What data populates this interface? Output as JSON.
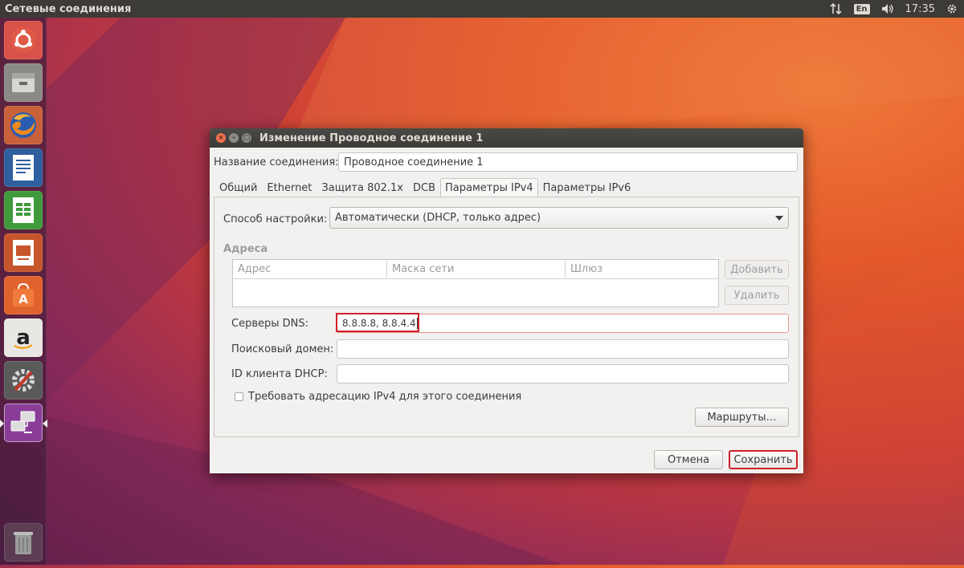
{
  "top_panel": {
    "app_title": "Сетевые соединения",
    "language": "En",
    "clock": "17:35"
  },
  "launcher": {
    "items": [
      "ubuntu-dash",
      "files",
      "firefox",
      "libreoffice-writer",
      "libreoffice-calc",
      "libreoffice-impress",
      "ubuntu-software",
      "amazon",
      "system-settings",
      "network-connections",
      "trash"
    ]
  },
  "dialog": {
    "title": "Изменение Проводное соединение 1",
    "connection_name_label": "Название соединения:",
    "connection_name_value": "Проводное соединение 1",
    "tabs": [
      {
        "label": "Общий"
      },
      {
        "label": "Ethernet"
      },
      {
        "label": "Защита 802.1x"
      },
      {
        "label": "DCB"
      },
      {
        "label": "Параметры IPv4"
      },
      {
        "label": "Параметры IPv6"
      }
    ],
    "active_tab": "Параметры IPv4",
    "method_label": "Способ настройки:",
    "method_value": "Автоматически (DHCP, только адрес)",
    "addresses_heading": "Адреса",
    "addresses_columns": [
      "Адрес",
      "Маска сети",
      "Шлюз"
    ],
    "add_button": "Добавить",
    "delete_button": "Удалить",
    "dns_label": "Серверы DNS:",
    "dns_value": "8.8.8.8, 8.8.4.4",
    "search_domain_label": "Поисковый домен:",
    "search_domain_value": "",
    "dhcp_client_id_label": "ID клиента DHCP:",
    "dhcp_client_id_value": "",
    "require_ipv4_label": "Требовать адресацию IPv4 для этого соединения",
    "require_ipv4_checked": false,
    "routes_button": "Маршруты…",
    "cancel_button": "Отмена",
    "save_button": "Сохранить"
  },
  "colors": {
    "highlight": "#d0202a",
    "panel": "#3d3b37",
    "dialog_bg": "#f2f1f0"
  }
}
